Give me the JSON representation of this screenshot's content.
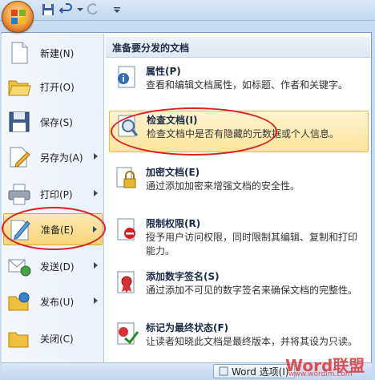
{
  "left_menu": [
    {
      "label": "新建(N)",
      "icon": "new-document-icon",
      "has_arrow": false
    },
    {
      "label": "打开(O)",
      "icon": "open-folder-icon",
      "has_arrow": false
    },
    {
      "label": "保存(S)",
      "icon": "save-disk-icon",
      "has_arrow": false
    },
    {
      "label": "另存为(A)",
      "icon": "save-as-icon",
      "has_arrow": true
    },
    {
      "label": "打印(P)",
      "icon": "printer-icon",
      "has_arrow": true
    },
    {
      "label": "准备(E)",
      "icon": "prepare-icon",
      "has_arrow": true,
      "active": true
    },
    {
      "label": "发送(D)",
      "icon": "send-icon",
      "has_arrow": true
    },
    {
      "label": "发布(U)",
      "icon": "publish-icon",
      "has_arrow": true
    },
    {
      "label": "关闭(C)",
      "icon": "close-folder-icon",
      "has_arrow": false
    }
  ],
  "right_panel": {
    "header": "准备要分发的文档",
    "items": [
      {
        "title": "属性(P)",
        "desc": "查看和编辑文档属性，如标题、作者和关键字。",
        "icon": "properties-icon"
      },
      {
        "title": "检查文档(I)",
        "desc": "检查文档中是否有隐藏的元数据或个人信息。",
        "icon": "inspect-document-icon",
        "hover": true
      },
      {
        "title": "加密文档(E)",
        "desc": "通过添加加密来增强文档的安全性。",
        "icon": "encrypt-lock-icon"
      },
      {
        "title": "限制权限(R)",
        "desc": "授予用户访问权限，同时限制其编辑、复制和打印能力。",
        "icon": "restrict-permission-icon"
      },
      {
        "title": "添加数字签名(S)",
        "desc": "通过添加不可见的数字签名来确保文档的完整性。",
        "icon": "digital-signature-icon"
      },
      {
        "title": "标记为最终状态(F)",
        "desc": "让读者知晓此文档是最终版本，并将其设为只读。",
        "icon": "mark-final-icon"
      }
    ]
  },
  "footer": {
    "word_options_label": "Word 选项(I)"
  },
  "watermark": {
    "text": "Word联盟",
    "sub": "www.wordlm.com"
  },
  "colors": {
    "accent_orange": "#f6a84a",
    "highlight": "#ffe59a",
    "annotation_red": "#e02020"
  }
}
